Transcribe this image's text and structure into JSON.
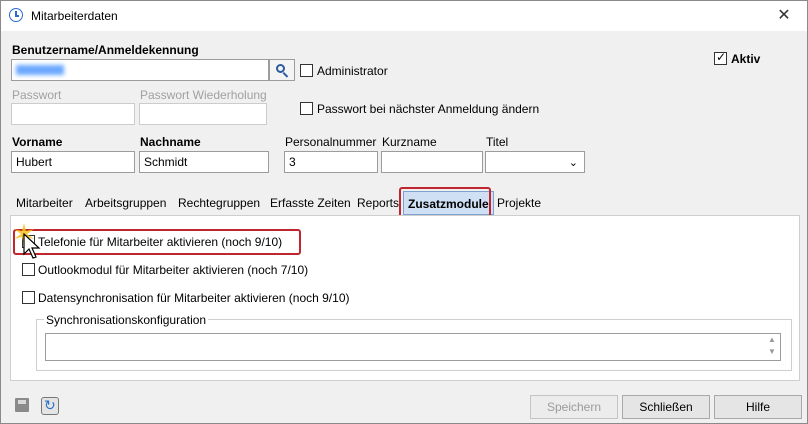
{
  "window": {
    "title": "Mitarbeiterdaten",
    "close_symbol": "✕"
  },
  "user": {
    "username_label": "Benutzername/Anmeldekennung",
    "admin_label": "Administrator",
    "aktiv_label": "Aktiv",
    "aktiv_checked": true,
    "admin_checked": false
  },
  "password": {
    "label": "Passwort",
    "repeat_label": "Passwort Wiederholung",
    "change_next_login_label": "Passwort bei nächster Anmeldung ändern"
  },
  "person": {
    "first_name_label": "Vorname",
    "first_name": "Hubert",
    "last_name_label": "Nachname",
    "last_name": "Schmidt",
    "personnel_number_label": "Personalnummer",
    "personnel_number": "3",
    "short_name_label": "Kurzname",
    "short_name": "",
    "title_label": "Titel",
    "title": ""
  },
  "tabs": [
    {
      "label": "Mitarbeiter"
    },
    {
      "label": "Arbeitsgruppen"
    },
    {
      "label": "Rechtegruppen"
    },
    {
      "label": "Erfasste Zeiten"
    },
    {
      "label": "Reports"
    },
    {
      "label": "Zusatzmodule",
      "active": true
    },
    {
      "label": "Projekte"
    }
  ],
  "modules": {
    "telephony_label": "Telefonie für Mitarbeiter aktivieren (noch 9/10)",
    "outlook_label": "Outlookmodul für Mitarbeiter aktivieren (noch 7/10)",
    "datasync_label": "Datensynchronisation für Mitarbeiter aktivieren (noch 9/10)",
    "sync_config_label": "Synchronisationskonfiguration",
    "sync_config_value": ""
  },
  "buttons": {
    "save": "Speichern",
    "close": "Schließen",
    "help": "Hilfe"
  },
  "colors": {
    "highlight": "#c0262e",
    "active_tab": "#cfe0f4"
  }
}
